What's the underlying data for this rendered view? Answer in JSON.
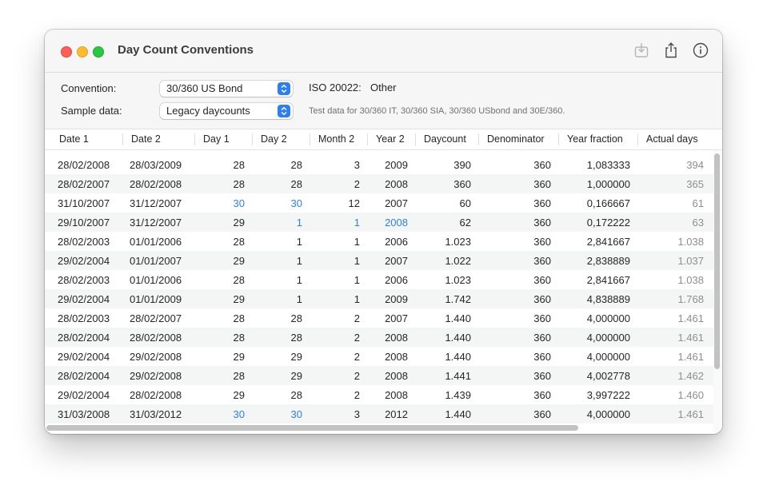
{
  "window": {
    "title": "Day Count Conventions",
    "toolbar": {
      "download_icon": "download-icon",
      "share_icon": "share-icon",
      "info_icon": "info-icon"
    }
  },
  "controls": {
    "convention_label": "Convention:",
    "convention_value": "30/360 US Bond",
    "iso_label": "ISO 20022:",
    "iso_value": "Other",
    "sample_label": "Sample data:",
    "sample_value": "Legacy daycounts",
    "sample_hint": "Test data for 30/360 IT, 30/360 SIA, 30/360 USbond and 30E/360.",
    "accent_color": "#2a7ff6"
  },
  "table": {
    "columns": [
      "Date 1",
      "Date 2",
      "Day 1",
      "Day 2",
      "Month 2",
      "Year 2",
      "Daycount",
      "Denominator",
      "Year fraction",
      "Actual days"
    ],
    "rows": [
      {
        "date1": "28/02/2008",
        "date2": "28/03/2009",
        "day1": "28",
        "day2": "28",
        "month2": "3",
        "year2": "2009",
        "daycount": "390",
        "denominator": "360",
        "yearfrac": "1,083333",
        "actual": "394"
      },
      {
        "date1": "28/02/2007",
        "date2": "28/02/2008",
        "day1": "28",
        "day2": "28",
        "month2": "2",
        "year2": "2008",
        "daycount": "360",
        "denominator": "360",
        "yearfrac": "1,000000",
        "actual": "365"
      },
      {
        "date1": "31/10/2007",
        "date2": "31/12/2007",
        "day1": "30",
        "day2": "30",
        "month2": "12",
        "year2": "2007",
        "daycount": "60",
        "denominator": "360",
        "yearfrac": "0,166667",
        "actual": "61"
      },
      {
        "date1": "29/10/2007",
        "date2": "31/12/2007",
        "day1": "29",
        "day2": "1",
        "month2": "1",
        "year2": "2008",
        "daycount": "62",
        "denominator": "360",
        "yearfrac": "0,172222",
        "actual": "63"
      },
      {
        "date1": "28/02/2003",
        "date2": "01/01/2006",
        "day1": "28",
        "day2": "1",
        "month2": "1",
        "year2": "2006",
        "daycount": "1.023",
        "denominator": "360",
        "yearfrac": "2,841667",
        "actual": "1.038"
      },
      {
        "date1": "29/02/2004",
        "date2": "01/01/2007",
        "day1": "29",
        "day2": "1",
        "month2": "1",
        "year2": "2007",
        "daycount": "1.022",
        "denominator": "360",
        "yearfrac": "2,838889",
        "actual": "1.037"
      },
      {
        "date1": "28/02/2003",
        "date2": "01/01/2006",
        "day1": "28",
        "day2": "1",
        "month2": "1",
        "year2": "2006",
        "daycount": "1.023",
        "denominator": "360",
        "yearfrac": "2,841667",
        "actual": "1.038"
      },
      {
        "date1": "29/02/2004",
        "date2": "01/01/2009",
        "day1": "29",
        "day2": "1",
        "month2": "1",
        "year2": "2009",
        "daycount": "1.742",
        "denominator": "360",
        "yearfrac": "4,838889",
        "actual": "1.768"
      },
      {
        "date1": "28/02/2003",
        "date2": "28/02/2007",
        "day1": "28",
        "day2": "28",
        "month2": "2",
        "year2": "2007",
        "daycount": "1.440",
        "denominator": "360",
        "yearfrac": "4,000000",
        "actual": "1.461"
      },
      {
        "date1": "28/02/2004",
        "date2": "28/02/2008",
        "day1": "28",
        "day2": "28",
        "month2": "2",
        "year2": "2008",
        "daycount": "1.440",
        "denominator": "360",
        "yearfrac": "4,000000",
        "actual": "1.461"
      },
      {
        "date1": "29/02/2004",
        "date2": "29/02/2008",
        "day1": "29",
        "day2": "29",
        "month2": "2",
        "year2": "2008",
        "daycount": "1.440",
        "denominator": "360",
        "yearfrac": "4,000000",
        "actual": "1.461"
      },
      {
        "date1": "28/02/2004",
        "date2": "29/02/2008",
        "day1": "28",
        "day2": "29",
        "month2": "2",
        "year2": "2008",
        "daycount": "1.441",
        "denominator": "360",
        "yearfrac": "4,002778",
        "actual": "1.462"
      },
      {
        "date1": "29/02/2004",
        "date2": "28/02/2008",
        "day1": "29",
        "day2": "28",
        "month2": "2",
        "year2": "2008",
        "daycount": "1.439",
        "denominator": "360",
        "yearfrac": "3,997222",
        "actual": "1.460"
      },
      {
        "date1": "31/03/2008",
        "date2": "31/03/2012",
        "day1": "30",
        "day2": "30",
        "month2": "3",
        "year2": "2012",
        "daycount": "1.440",
        "denominator": "360",
        "yearfrac": "4,000000",
        "actual": "1.461"
      }
    ],
    "highlights": [
      {
        "row": 2,
        "cols": [
          "day1",
          "day2"
        ]
      },
      {
        "row": 3,
        "cols": [
          "day2",
          "month2",
          "year2"
        ]
      },
      {
        "row": 13,
        "cols": [
          "day1",
          "day2"
        ]
      }
    ]
  }
}
